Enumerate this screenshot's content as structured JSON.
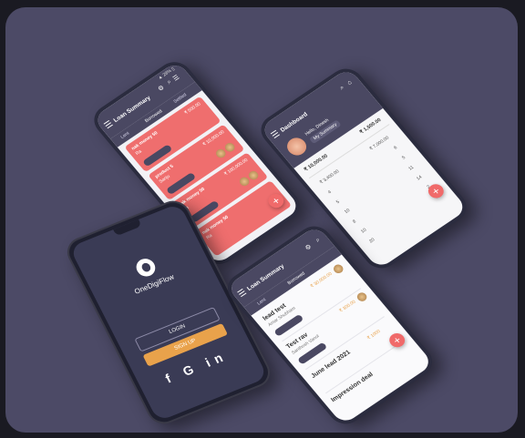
{
  "phone1": {
    "status": "▲ 28% ▯",
    "title": "Loan Summary",
    "icons": {
      "settings": "⚙",
      "search": "⌕",
      "filter": "☰",
      "home": "⌂"
    },
    "tabs": [
      "Lent",
      "Borrowed",
      "Settled"
    ],
    "cards": [
      {
        "title": "nak money 50",
        "sub": "Ra",
        "amount": "₹ 500.00"
      },
      {
        "title": "product 5",
        "sub": "Sanju",
        "amount": "₹ 10,000.00"
      },
      {
        "title": "nak money 50",
        "sub": "Ra",
        "amount": "₹ 100,000.00"
      },
      {
        "title": "nak money 50",
        "sub": "Ra",
        "amount": ""
      }
    ],
    "fab": "+"
  },
  "phone2": {
    "title": "Dashboard",
    "profile": {
      "line1": "Hello, Dinesh",
      "line2": "My Summary"
    },
    "totals": [
      "₹ 10,000.00",
      "₹ 1,500.00"
    ],
    "rows_left": [
      "₹ 3,400.00",
      "4",
      "5",
      "10",
      "8",
      "10",
      "20"
    ],
    "rows_right": [
      "₹ 7,000.00",
      "6",
      "5",
      "11",
      "14",
      "2",
      "8"
    ],
    "fab": "+"
  },
  "phone3": {
    "brand": "OneDigiFlow",
    "login_label": "LOGIN",
    "signup_label": "SIGN UP",
    "social": {
      "facebook": "f",
      "google": "G",
      "linkedin": "in"
    }
  },
  "phone4": {
    "title": "Loan Summary",
    "tabs": [
      "Lent",
      "Borrowed"
    ],
    "items": [
      {
        "title": "lead test",
        "sub": "Amar Shubham",
        "amount": "₹ 30,000.00"
      },
      {
        "title": "Test rav",
        "sub": "Santhosh Vanol",
        "amount": "₹ 300.00"
      },
      {
        "title": "June lead 2021",
        "sub": "",
        "amount": "₹ 1000"
      },
      {
        "title": "Impression deal",
        "sub": "",
        "amount": ""
      }
    ],
    "fab": "+"
  },
  "colors": {
    "background": "#4c4a66",
    "accent": "#f06a6a",
    "header": "#4a4862",
    "signup": "#e9a24b"
  }
}
